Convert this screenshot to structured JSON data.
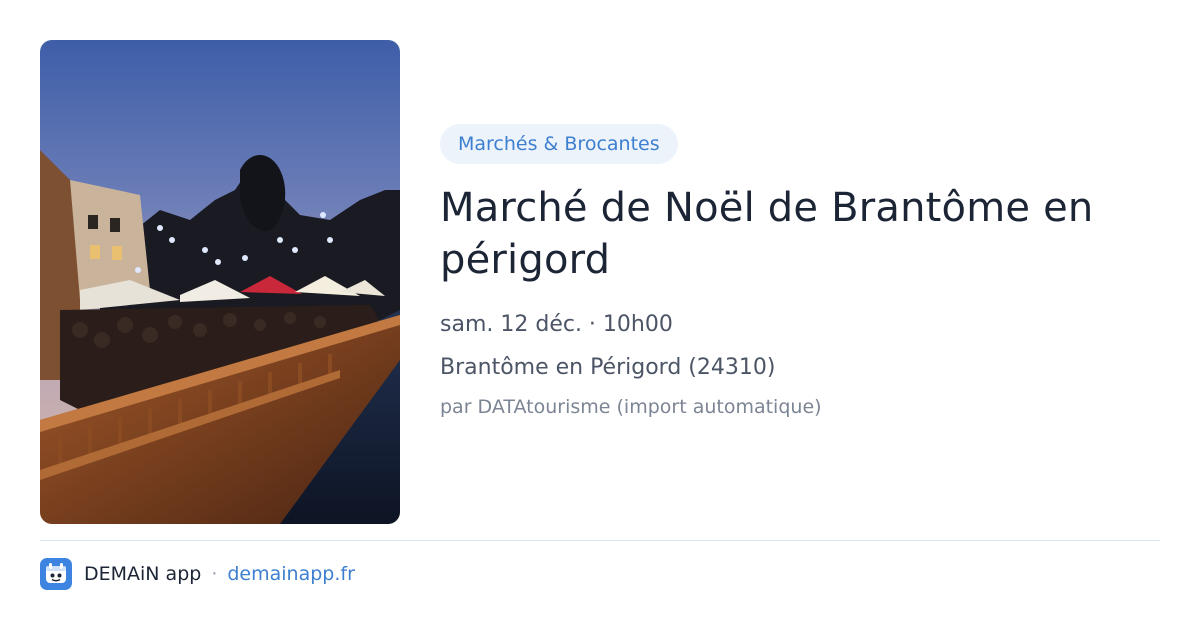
{
  "event": {
    "category": "Marchés & Brocantes",
    "title": "Marché de Noël de Brantôme en périgord",
    "date": "sam. 12 déc. · 10h00",
    "location": "Brantôme en Périgord (24310)",
    "source": "par DATAtourisme (import automatique)"
  },
  "footer": {
    "app_name": "DEMAiN app",
    "separator": "·",
    "domain": "demainapp.fr"
  },
  "colors": {
    "accent": "#3d7fd0",
    "badge_bg": "#edf3fb",
    "title": "#1c2535"
  },
  "icons": {
    "app": "demain-app-icon"
  }
}
